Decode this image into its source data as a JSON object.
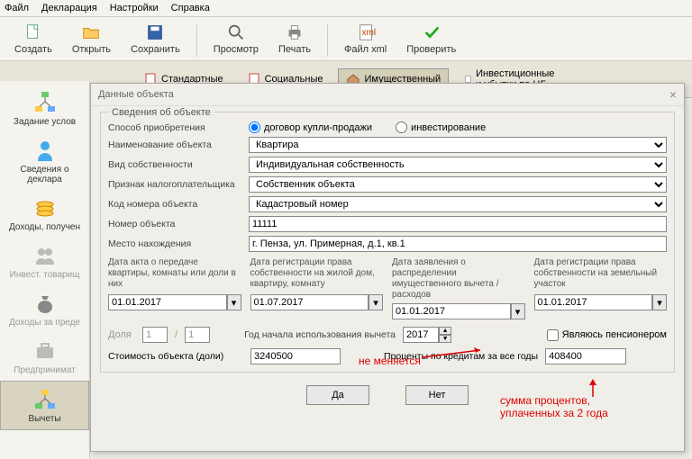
{
  "menu": {
    "file": "Файл",
    "decl": "Декларация",
    "settings": "Настройки",
    "help": "Справка"
  },
  "tools": {
    "create": "Создать",
    "open": "Открыть",
    "save": "Сохранить",
    "preview": "Просмотр",
    "print": "Печать",
    "xml": "Файл xml",
    "check": "Проверить"
  },
  "tabs": {
    "std": "Стандартные",
    "soc": "Социальные",
    "prop": "Имущественный",
    "inv": "Инвестиционные и убытки по ЦБ"
  },
  "side": {
    "cond": "Задание услов",
    "info": "Сведения о деклара",
    "income": "Доходы, получен",
    "invest": "Инвест. товарищ",
    "abroad": "Доходы за преде",
    "entre": "Предпринимат",
    "deduct": "Вычеты"
  },
  "dialog": {
    "title": "Данные объекта",
    "section": "Сведения об объекте",
    "method_lbl": "Способ приобретения",
    "method_buy": "договор купли-продажи",
    "method_inv": "инвестирование",
    "name_lbl": "Наименование объекта",
    "name_val": "Квартира",
    "own_lbl": "Вид собственности",
    "own_val": "Индивидуальная собственность",
    "tax_lbl": "Признак налогоплательщика",
    "tax_val": "Собственник объекта",
    "code_lbl": "Код номера объекта",
    "code_val": "Кадастровый номер",
    "num_lbl": "Номер объекта",
    "num_val": "11111",
    "loc_lbl": "Место нахождения",
    "loc_val": "г. Пенза, ул. Примерная, д.1, кв.1",
    "d1_lbl": "Дата акта о передаче квартиры, комнаты или доли в них",
    "d1_val": "01.01.2017",
    "d2_lbl": "Дата регистрации права собственности на жилой дом, квартиру, комнату",
    "d2_val": "01.07.2017",
    "d3_lbl": "Дата заявления о распределении имущественного вычета / расходов",
    "d3_val": "01.01.2017",
    "d4_lbl": "Дата регистрации права собственности на земельный участок",
    "d4_val": "01.01.2017",
    "share_lbl": "Доля",
    "share_a": "1",
    "share_b": "1",
    "year_lbl": "Год начала использования вычета",
    "year_val": "2017",
    "pension": "Являюсь пенсионером",
    "cost_lbl": "Стоимость объекта (доли)",
    "cost_val": "3240500",
    "pct_lbl": "Проценты по кредитам за все годы",
    "pct_val": "408400",
    "ok": "Да",
    "cancel": "Нет"
  },
  "annot": {
    "a1": "не меняется",
    "a2": "сумма процентов,\nуплаченных за 2 года"
  }
}
